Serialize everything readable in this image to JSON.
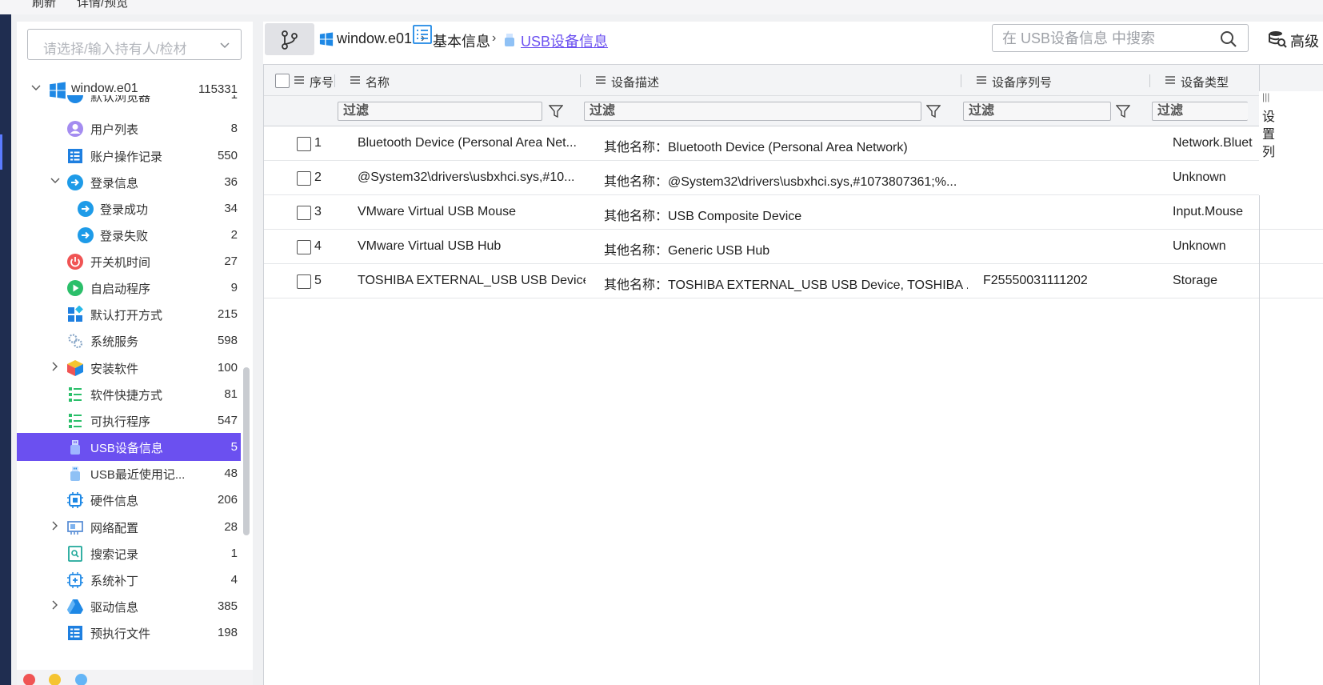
{
  "topbar": {
    "refresh": "刷新",
    "detail_preview": "详情/预览"
  },
  "sidebar": {
    "owner_placeholder": "请选择/输入持有人/检材",
    "root": {
      "label": "window.e01",
      "count": "115331"
    },
    "partial_top": {
      "label": "默认浏览器",
      "count": "1"
    },
    "items": [
      {
        "label": "用户列表",
        "count": "8"
      },
      {
        "label": "账户操作记录",
        "count": "550"
      },
      {
        "label": "登录信息",
        "count": "36"
      },
      {
        "label": "登录成功",
        "count": "34"
      },
      {
        "label": "登录失败",
        "count": "2"
      },
      {
        "label": "开关机时间",
        "count": "27"
      },
      {
        "label": "自启动程序",
        "count": "9"
      },
      {
        "label": "默认打开方式",
        "count": "215"
      },
      {
        "label": "系统服务",
        "count": "598"
      },
      {
        "label": "安装软件",
        "count": "100"
      },
      {
        "label": "软件快捷方式",
        "count": "81"
      },
      {
        "label": "可执行程序",
        "count": "547"
      },
      {
        "label": "USB设备信息",
        "count": "5"
      },
      {
        "label": "USB最近使用记...",
        "count": "48"
      },
      {
        "label": "硬件信息",
        "count": "206"
      },
      {
        "label": "网络配置",
        "count": "28"
      },
      {
        "label": "搜索记录",
        "count": "1"
      },
      {
        "label": "系统补丁",
        "count": "4"
      },
      {
        "label": "驱动信息",
        "count": "385"
      },
      {
        "label": "预执行文件",
        "count": "198"
      }
    ]
  },
  "breadcrumb": {
    "root": "window.e01",
    "parent": "基本信息",
    "current": "USB设备信息"
  },
  "search": {
    "placeholder": "在 USB设备信息 中搜索"
  },
  "advanced": {
    "label": "高级"
  },
  "table": {
    "headers": {
      "index": "序号",
      "name": "名称",
      "desc": "设备描述",
      "serial": "设备序列号",
      "type": "设备类型"
    },
    "filter_placeholder": "过滤",
    "rows": [
      {
        "no": "1",
        "name": "Bluetooth Device (Personal Area Net...",
        "desc": "其他名称：Bluetooth Device (Personal Area Network)",
        "serial": "",
        "type": "Network.Bluet"
      },
      {
        "no": "2",
        "name": "@System32\\drivers\\usbxhci.sys,#10...",
        "desc": "其他名称：@System32\\drivers\\usbxhci.sys,#1073807361;%...",
        "serial": "",
        "type": "Unknown"
      },
      {
        "no": "3",
        "name": "VMware Virtual USB Mouse",
        "desc": "其他名称：USB Composite Device",
        "serial": "",
        "type": "Input.Mouse"
      },
      {
        "no": "4",
        "name": "VMware Virtual USB Hub",
        "desc": "其他名称：Generic USB Hub",
        "serial": "",
        "type": "Unknown"
      },
      {
        "no": "5",
        "name": "TOSHIBA EXTERNAL_USB USB Device",
        "desc": "其他名称：TOSHIBA EXTERNAL_USB USB Device, TOSHIBA ...",
        "serial": "F25550031111202",
        "type": "Storage"
      }
    ]
  },
  "right_panel": {
    "col_settings": [
      "设",
      "置",
      "列"
    ]
  },
  "colors": {
    "accent": "#6b50f0",
    "sidebar_dark": "#1f2d50"
  }
}
